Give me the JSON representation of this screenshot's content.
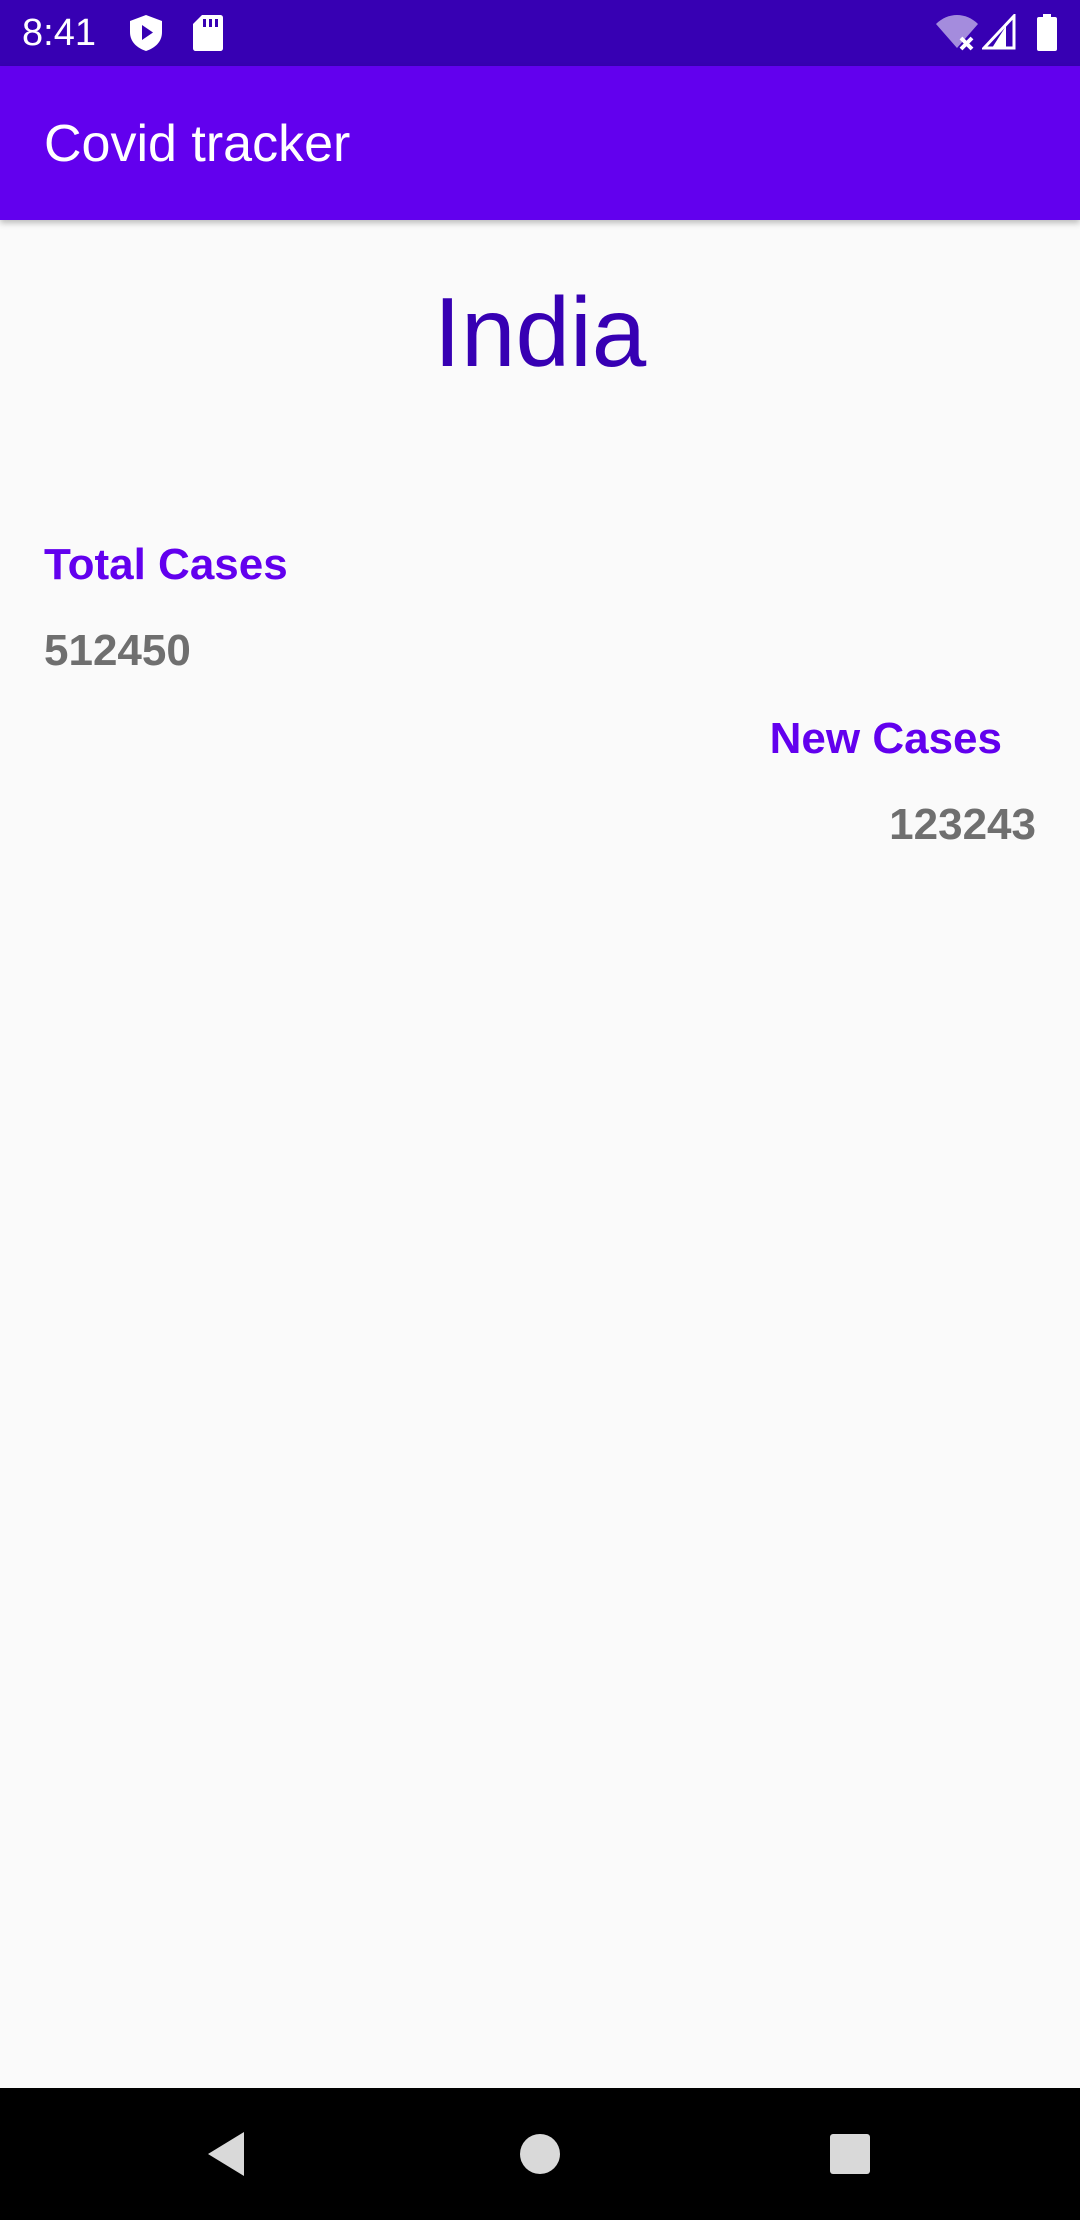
{
  "status_bar": {
    "time": "8:41",
    "icons": [
      "shield-play-icon",
      "sd-card-icon",
      "wifi-off-icon",
      "cell-signal-icon",
      "battery-icon"
    ]
  },
  "app_bar": {
    "title": "Covid tracker"
  },
  "main": {
    "country": "India",
    "total_cases_label": "Total Cases",
    "total_cases_value": "512450",
    "new_cases_label": "New Cases",
    "new_cases_value": "123243"
  },
  "nav_bar": {
    "buttons": [
      "back-icon",
      "home-icon",
      "recents-icon"
    ]
  },
  "colors": {
    "status_bar": "#3700b3",
    "app_bar": "#6200ee",
    "country_text": "#3700b3",
    "label_text": "#6200ee",
    "value_text": "#6f6f6f",
    "background": "#fafafa"
  }
}
